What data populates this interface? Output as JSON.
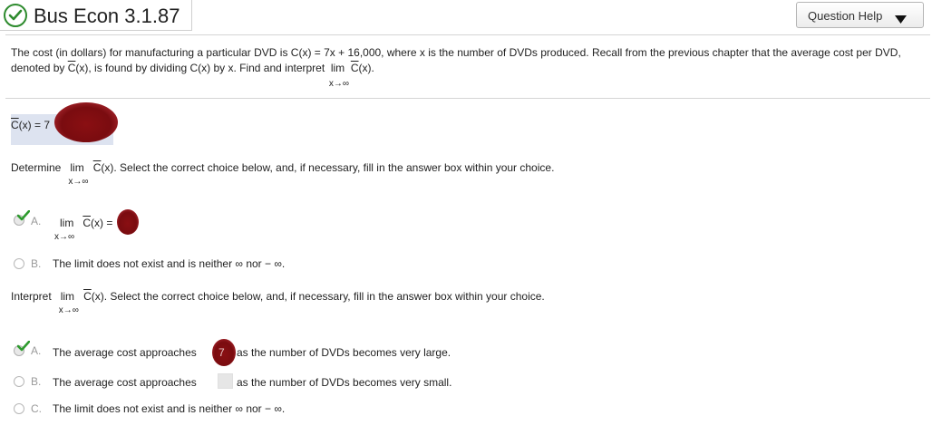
{
  "header": {
    "title": "Bus Econ 3.1.87",
    "help_label": "Question Help"
  },
  "question": {
    "text_part1": "The cost (in dollars) for manufacturing a particular DVD is C(x) = 7x + 16,000, where x is the number of DVDs produced. Recall from the previous chapter that the average cost per DVD, denoted by ",
    "cbar": "C",
    "text_part2": "(x), is found by dividing C(x) by x. Find and interpret",
    "lim": "lim",
    "lim_sub": "x→∞",
    "cbar_expr_tail": "(x)."
  },
  "cbar_answer": {
    "label_tail": "(x) = 7"
  },
  "part1": {
    "prompt_pre": "Determine",
    "prompt_post": "(x). Select the correct choice below, and, if necessary, fill in the answer box within your choice.",
    "choice_a_letter": "A.",
    "choice_a_tail": "(x) =",
    "choice_b_letter": "B.",
    "choice_b_text": "The limit does not exist and is neither ∞ nor − ∞."
  },
  "part2": {
    "prompt_pre": "Interpret",
    "prompt_post": "(x). Select the correct choice below, and, if necessary, fill in the answer box within your choice.",
    "choice_a_letter": "A.",
    "choice_a_pre": "The average cost approaches",
    "choice_a_value": "7",
    "choice_a_post": "as the number of DVDs becomes very large.",
    "choice_b_letter": "B.",
    "choice_b_pre": "The average cost approaches",
    "choice_b_post": "as the number of DVDs becomes very small.",
    "choice_c_letter": "C.",
    "choice_c_text": "The limit does not exist and is neither ∞ nor − ∞."
  },
  "colors": {
    "check_green": "#2e8b2e",
    "redaction": "#7a0c10",
    "answer_field_bg": "#dde3f0"
  }
}
